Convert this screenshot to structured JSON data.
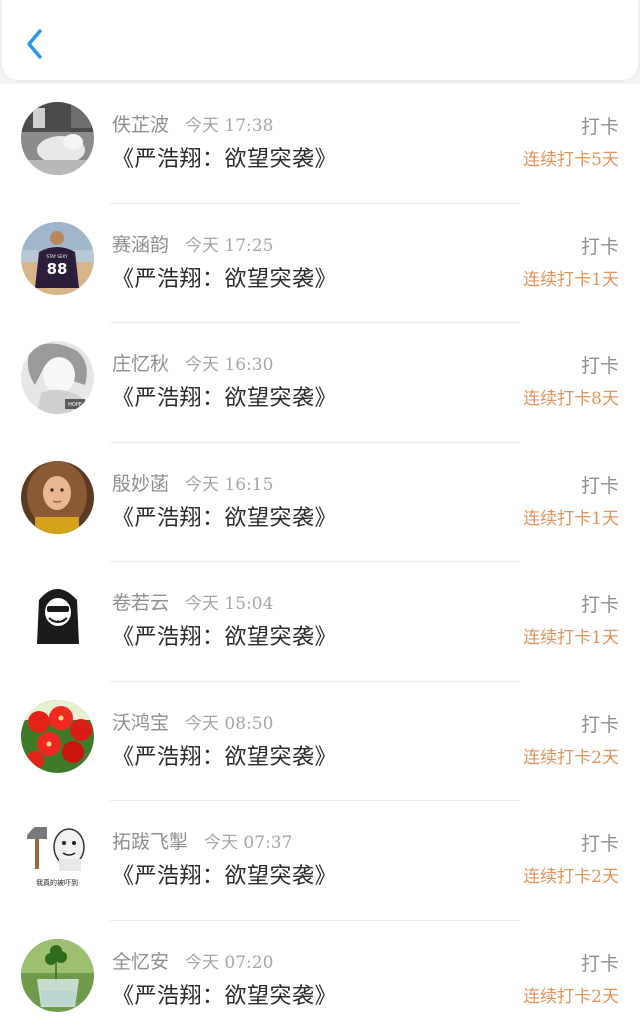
{
  "header": {
    "back_icon": "chevron-left-icon",
    "accent_color": "#2196f3"
  },
  "entries": [
    {
      "name": "佚芷波",
      "time": "今天 17:38",
      "book": "《严浩翔：欲望突袭》",
      "action": "打卡",
      "streak": "连续打卡5天",
      "avatar": "photo-cat-sleeping"
    },
    {
      "name": "赛涵韵",
      "time": "今天 17:25",
      "book": "《严浩翔：欲望突袭》",
      "action": "打卡",
      "streak": "连续打卡1天",
      "avatar": "photo-jersey-88-beach"
    },
    {
      "name": "庄忆秋",
      "time": "今天 16:30",
      "book": "《严浩翔：欲望突袭》",
      "action": "打卡",
      "streak": "连续打卡8天",
      "avatar": "anime-girl-sketch"
    },
    {
      "name": "殷妙菡",
      "time": "今天 16:15",
      "book": "《严浩翔：欲望突袭》",
      "action": "打卡",
      "streak": "连续打卡1天",
      "avatar": "photo-girl-curly-hair"
    },
    {
      "name": "卷若云",
      "time": "今天 15:04",
      "book": "《严浩翔：欲望突袭》",
      "action": "打卡",
      "streak": "连续打卡1天",
      "avatar": "cartoon-hooded-grin"
    },
    {
      "name": "沃鸿宝",
      "time": "今天 08:50",
      "book": "《严浩翔：欲望突袭》",
      "action": "打卡",
      "streak": "连续打卡2天",
      "avatar": "photo-red-flowers"
    },
    {
      "name": "拓跋飞掣",
      "time": "今天 07:37",
      "book": "《严浩翔：欲望突袭》",
      "action": "打卡",
      "streak": "连续打卡2天",
      "avatar": "meme-hammer-face",
      "avatar_caption": "我真的被吓到"
    },
    {
      "name": "全忆安",
      "time": "今天 07:20",
      "book": "《严浩翔：欲望突袭》",
      "action": "打卡",
      "streak": "连续打卡2天",
      "avatar": "photo-clover-jar"
    }
  ]
}
